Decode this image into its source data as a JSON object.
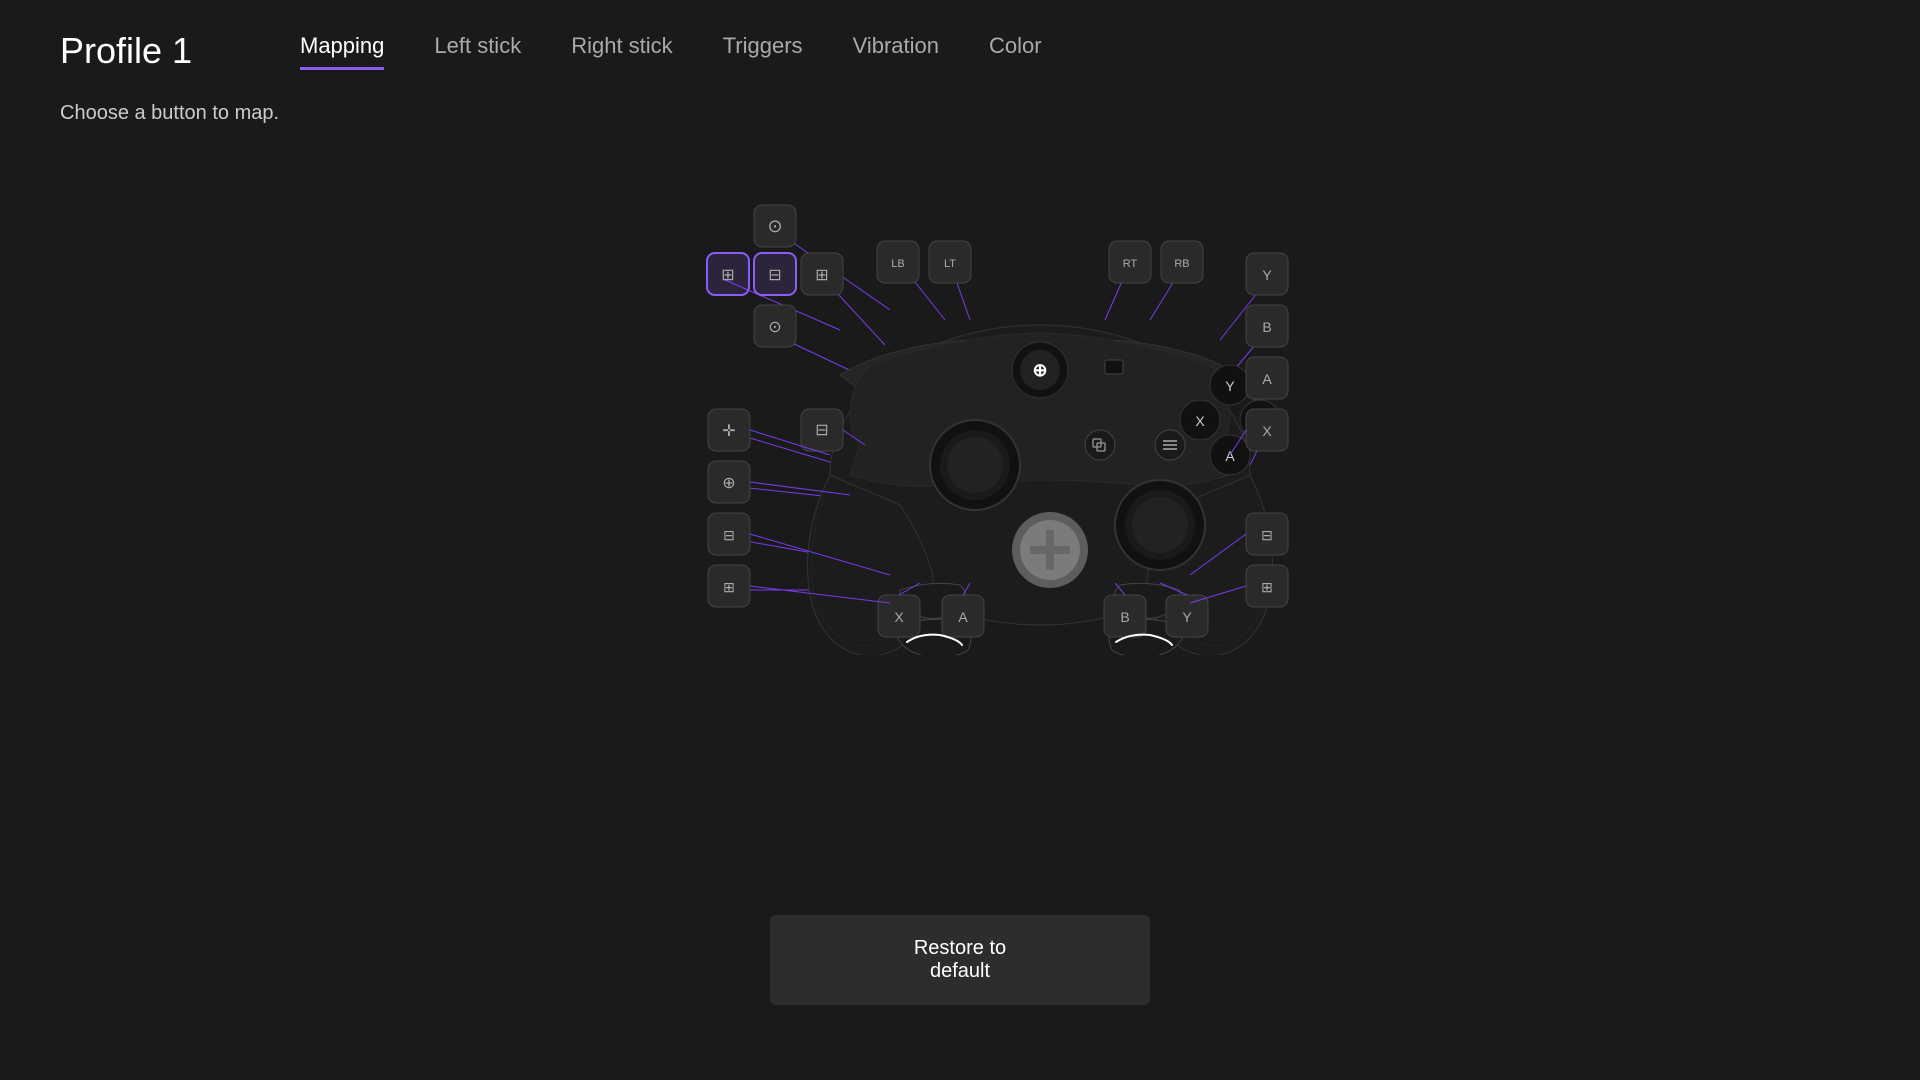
{
  "header": {
    "profile_title": "Profile 1",
    "tabs": [
      {
        "id": "mapping",
        "label": "Mapping",
        "active": true
      },
      {
        "id": "left-stick",
        "label": "Left stick",
        "active": false
      },
      {
        "id": "right-stick",
        "label": "Right stick",
        "active": false
      },
      {
        "id": "triggers",
        "label": "Triggers",
        "active": false
      },
      {
        "id": "vibration",
        "label": "Vibration",
        "active": false
      },
      {
        "id": "color",
        "label": "Color",
        "active": false
      }
    ]
  },
  "subtitle": "Choose a button to map.",
  "restore_button_label": "Restore to default",
  "colors": {
    "accent": "#8b5cf6",
    "background": "#1a1a1a",
    "button_bg": "#2a2a2a",
    "button_border": "#444",
    "line_color": "#7c3aed"
  }
}
